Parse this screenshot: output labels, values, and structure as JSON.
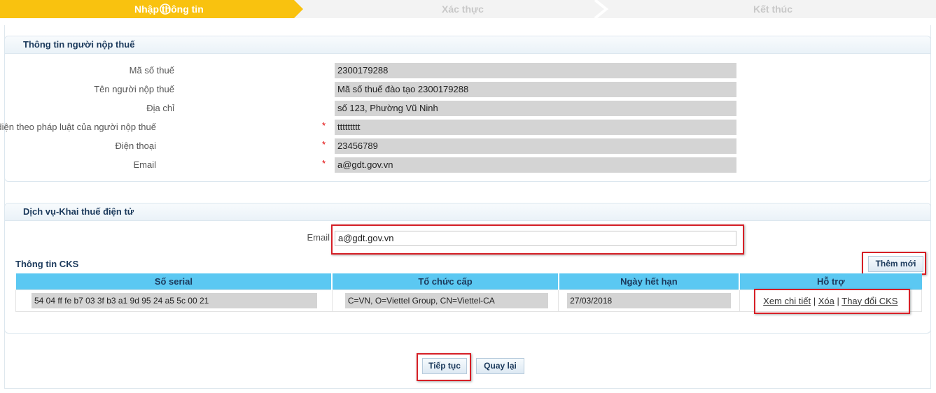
{
  "stepper": {
    "step1": "Nhập thông tin",
    "step2": "Xác thực",
    "step3": "Kết thúc"
  },
  "taxpayer": {
    "title": "Thông tin người nộp thuế",
    "fields": [
      {
        "label": "Mã số thuế",
        "value": "2300179288",
        "required": false
      },
      {
        "label": "Tên người nộp thuế",
        "value": "Mã số thuế đào tạo 2300179288",
        "required": false
      },
      {
        "label": "Địa chỉ",
        "value": "số 123, Phường Vũ Ninh",
        "required": false
      },
      {
        "label": "Người đại diện theo pháp luật của người nộp thuế",
        "value": "ttttttttt",
        "required": true
      },
      {
        "label": "Điện thoại",
        "value": "23456789",
        "required": true
      },
      {
        "label": "Email",
        "value": "a@gdt.gov.vn",
        "required": true
      }
    ]
  },
  "service": {
    "title": "Dịch vụ-Khai thuế điện tử",
    "email_label": "Email",
    "email_value": "a@gdt.gov.vn",
    "cks_title": "Thông tin CKS",
    "add_button": "Thêm mới",
    "table": {
      "headers": [
        "Số serial",
        "Tổ chức cấp",
        "Ngày hết hạn",
        "Hỗ trợ"
      ],
      "rows": [
        {
          "serial": "54 04 ff fe b7 03 3f b3 a1 9d 95 24 a5 5c 00 21",
          "issuer": "C=VN, O=Viettel Group, CN=Viettel-CA",
          "expiry": "27/03/2018",
          "actions": [
            "Xem chi tiết",
            "Xóa",
            "Thay đổi CKS"
          ],
          "separator": "|"
        }
      ]
    }
  },
  "footer": {
    "continue": "Tiếp tục",
    "back": "Quay lại"
  },
  "colors": {
    "active_step": "#f9c20f",
    "inactive_step": "#f2f2f2",
    "table_header": "#5bc8f2",
    "highlight": "#d61f26",
    "readonly_field": "#d4d4d4"
  }
}
